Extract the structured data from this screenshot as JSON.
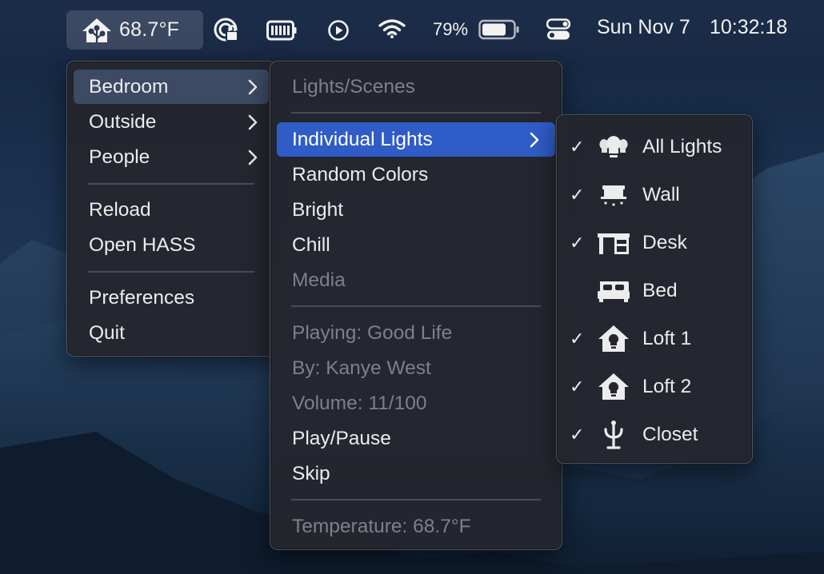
{
  "menubar": {
    "temperature": "68.7°F",
    "icons": [
      "home-assistant-icon",
      "airplay-lock-icon",
      "battery-status-icon",
      "play-circle-icon",
      "wifi-icon",
      "control-center-icon"
    ],
    "battery_percent": "79%",
    "battery_level": 0.79,
    "date": "Sun Nov 7",
    "time": "10:32:18"
  },
  "root_menu": {
    "items": [
      {
        "label": "Bedroom",
        "submenu": true,
        "highlighted": true
      },
      {
        "label": "Outside",
        "submenu": true
      },
      {
        "label": "People",
        "submenu": true
      },
      {
        "label": "Reload"
      },
      {
        "label": "Open HASS"
      },
      {
        "label": "Preferences"
      },
      {
        "label": "Quit"
      }
    ]
  },
  "bedroom_menu": {
    "header": "Lights/Scenes",
    "items": [
      {
        "label": "Individual Lights",
        "submenu": true,
        "selected": true
      },
      {
        "label": "Random Colors"
      },
      {
        "label": "Bright"
      },
      {
        "label": "Chill"
      },
      {
        "label": "Media",
        "disabled": true
      }
    ],
    "media_info": [
      {
        "label": "Playing: Good Life",
        "disabled": true
      },
      {
        "label": "By: Kanye West",
        "disabled": true
      },
      {
        "label": "Volume: 11/100",
        "disabled": true
      },
      {
        "label": "Play/Pause"
      },
      {
        "label": "Skip"
      }
    ],
    "temperature": "Temperature: 68.7°F"
  },
  "lights_menu": {
    "items": [
      {
        "label": "All Lights",
        "checked": true,
        "icon": "lightbulb-group-icon"
      },
      {
        "label": "Wall",
        "checked": true,
        "icon": "wall-sconce-icon"
      },
      {
        "label": "Desk",
        "checked": true,
        "icon": "desk-icon"
      },
      {
        "label": "Bed",
        "checked": false,
        "icon": "bed-icon"
      },
      {
        "label": "Loft 1",
        "checked": true,
        "icon": "home-lightbulb-icon"
      },
      {
        "label": "Loft 2",
        "checked": true,
        "icon": "home-lightbulb-icon"
      },
      {
        "label": "Closet",
        "checked": true,
        "icon": "coat-rack-icon"
      }
    ],
    "checkmark": "✓"
  }
}
